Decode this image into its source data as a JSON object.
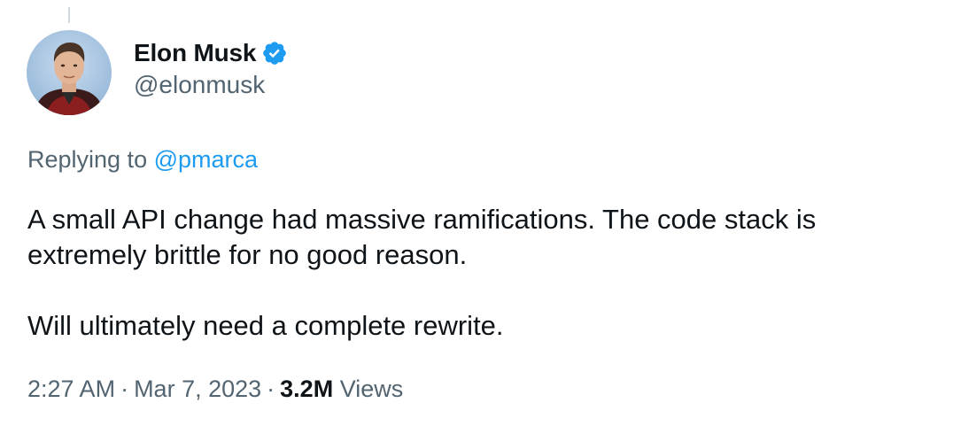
{
  "tweet": {
    "author": {
      "display_name": "Elon Musk",
      "handle": "@elonmusk",
      "verified": true,
      "avatar_icon": "profile-photo"
    },
    "replying_to": {
      "prefix": "Replying to",
      "handle": "@pmarca"
    },
    "paragraphs": [
      "A small API change had massive ramifications. The code stack is extremely brittle for no good reason.",
      "Will ultimately need a complete rewrite."
    ],
    "meta": {
      "time": "2:27 AM",
      "separator": "·",
      "date": "Mar 7, 2023",
      "views_count": "3.2M",
      "views_label": "Views"
    }
  },
  "colors": {
    "link": "#1d9bf0",
    "secondary_text": "#536471",
    "primary_text": "#0f1419",
    "verified_badge": "#1d9bf0"
  },
  "icons": {
    "verified": "verified-badge-icon"
  }
}
